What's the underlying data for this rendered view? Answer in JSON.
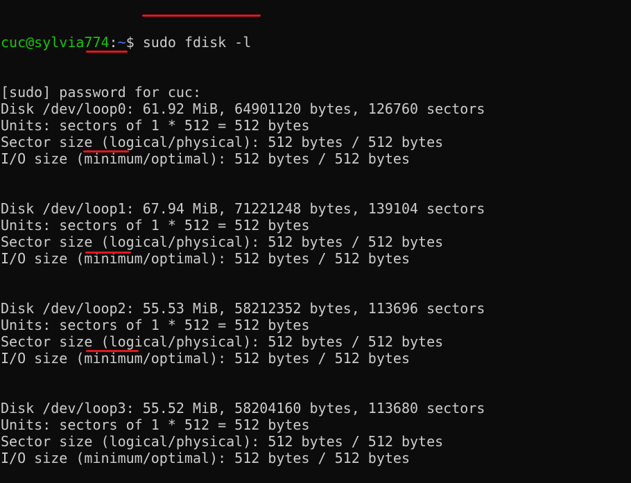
{
  "prompt": {
    "user_host": "cuc@sylvia774",
    "colon": ":",
    "path": "~",
    "symbol": "$ ",
    "command": "sudo fdisk -l"
  },
  "lines": [
    "[sudo] password for cuc:",
    "Disk /dev/loop0: 61.92 MiB, 64901120 bytes, 126760 sectors",
    "Units: sectors of 1 * 512 = 512 bytes",
    "Sector size (logical/physical): 512 bytes / 512 bytes",
    "I/O size (minimum/optimal): 512 bytes / 512 bytes",
    "",
    "",
    "Disk /dev/loop1: 67.94 MiB, 71221248 bytes, 139104 sectors",
    "Units: sectors of 1 * 512 = 512 bytes",
    "Sector size (logical/physical): 512 bytes / 512 bytes",
    "I/O size (minimum/optimal): 512 bytes / 512 bytes",
    "",
    "",
    "Disk /dev/loop2: 55.53 MiB, 58212352 bytes, 113696 sectors",
    "Units: sectors of 1 * 512 = 512 bytes",
    "Sector size (logical/physical): 512 bytes / 512 bytes",
    "I/O size (minimum/optimal): 512 bytes / 512 bytes",
    "",
    "",
    "Disk /dev/loop3: 55.52 MiB, 58204160 bytes, 113680 sectors",
    "Units: sectors of 1 * 512 = 512 bytes",
    "Sector size (logical/physical): 512 bytes / 512 bytes",
    "I/O size (minimum/optimal): 512 bytes / 512 bytes"
  ],
  "colors": {
    "background": "#0c0c0c",
    "text": "#cccccc",
    "prompt_user": "#16c60c",
    "prompt_path": "#3b78ff",
    "annotation": "#e3161d"
  }
}
